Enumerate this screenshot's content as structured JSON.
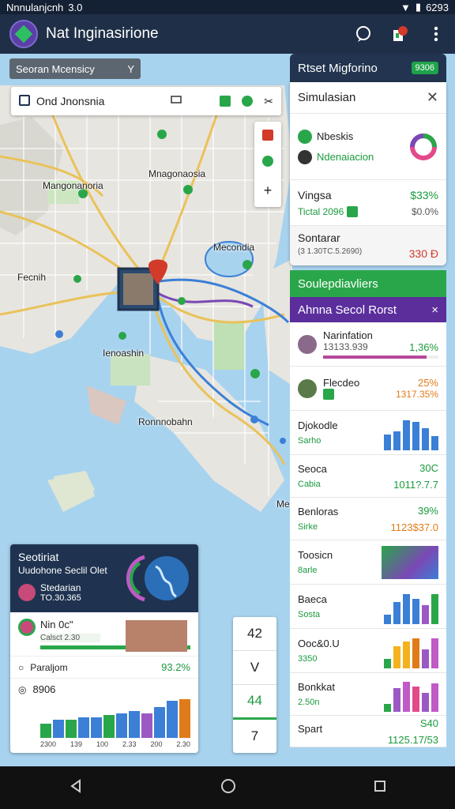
{
  "status_bar": {
    "carrier": "Nnnulanjcnh",
    "signal": "3.0",
    "battery": "6293"
  },
  "app_bar": {
    "title": "Nat Inginasirione"
  },
  "map": {
    "filter_chip": "Seoran Mcensicy",
    "search": {
      "value": "Ond Jnonsnia"
    },
    "labels": [
      "Mangonanoria",
      "Mnagonaosia",
      "Mecondia",
      "Fecnih",
      "Ienoashin",
      "Ronnnobahn",
      "Me"
    ],
    "tools": [
      "+"
    ],
    "zoom": [
      "42",
      "V",
      "44",
      "7"
    ]
  },
  "right_panel": {
    "header": {
      "title": "Rtset Migforino",
      "badge": "9306"
    },
    "simulation": {
      "title": "Simulasian",
      "items": [
        {
          "name": "Nbeskis"
        },
        {
          "name": "Ndenaiacion"
        }
      ]
    },
    "vingsa": {
      "label": "Vingsa",
      "value": "$33%",
      "sub": "Tictal 2096",
      "sub_value": "$0.0%"
    },
    "sontarar": {
      "label": "Sontarar",
      "sub": "(3 1.30TC.5.2690)",
      "value": "330 Ð"
    }
  },
  "results_panel": {
    "green_header": "Soulepdiavliers",
    "purple_header": "Ahnna Secol Rorst",
    "items": [
      {
        "name": "Narinfation",
        "sub": "13133.939",
        "value": "1,36%",
        "progress": 0.9,
        "progress_color": "#b7479a"
      },
      {
        "name": "Flecdeo",
        "sub": "",
        "value": "25%",
        "sub_value": "1317.35%"
      }
    ],
    "stats": [
      {
        "name": "Djokodle",
        "sub": "Sarho",
        "bars": [
          {
            "v": 0.5,
            "c": "#3b7fd6"
          },
          {
            "v": 0.6,
            "c": "#3b7fd6"
          },
          {
            "v": 0.95,
            "c": "#3b7fd6"
          },
          {
            "v": 0.9,
            "c": "#3b7fd6"
          },
          {
            "v": 0.7,
            "c": "#3b7fd6"
          },
          {
            "v": 0.45,
            "c": "#3b7fd6"
          }
        ]
      },
      {
        "name": "Seoca",
        "sub": "Cabia",
        "value": "30C",
        "sub_value": "1011?.7.7"
      },
      {
        "name": "Benloras",
        "sub": "Sirke",
        "value": "39%",
        "sub_value": "1123$37.0"
      },
      {
        "name": "Toosicn",
        "sub": "8arle"
      },
      {
        "name": "Baeca",
        "sub": "Sosta",
        "bars": [
          {
            "v": 0.3,
            "c": "#3b7fd6"
          },
          {
            "v": 0.7,
            "c": "#3b7fd6"
          },
          {
            "v": 0.95,
            "c": "#3b7fd6"
          },
          {
            "v": 0.8,
            "c": "#3b7fd6"
          },
          {
            "v": 0.6,
            "c": "#9b59c4"
          },
          {
            "v": 0.95,
            "c": "#2aa64a"
          }
        ]
      },
      {
        "name": "Ooc&0.U",
        "sub": "3350",
        "bars": [
          {
            "v": 0.3,
            "c": "#2aa64a"
          },
          {
            "v": 0.7,
            "c": "#f5b21f"
          },
          {
            "v": 0.85,
            "c": "#f5b21f"
          },
          {
            "v": 0.95,
            "c": "#e07b1a"
          },
          {
            "v": 0.6,
            "c": "#9b59c4"
          },
          {
            "v": 0.95,
            "c": "#c05ac6"
          }
        ]
      },
      {
        "name": "Bonkkat",
        "sub": "2.50n",
        "bars": [
          {
            "v": 0.25,
            "c": "#2aa64a"
          },
          {
            "v": 0.75,
            "c": "#9b59c4"
          },
          {
            "v": 0.95,
            "c": "#c05ac6"
          },
          {
            "v": 0.8,
            "c": "#e24a8a"
          },
          {
            "v": 0.6,
            "c": "#9b59c4"
          },
          {
            "v": 0.9,
            "c": "#c05ac6"
          }
        ]
      },
      {
        "name": "Spart",
        "sub": "",
        "value": "S40",
        "sub_value": "1125.17/53"
      }
    ]
  },
  "bottom_card": {
    "title": "Seotiriat",
    "subtitle": "Uudohone Seclil Olet",
    "user": {
      "name": "Stedarian",
      "sub": "TO.30.365"
    },
    "metric": {
      "label": "Nin 0c\"",
      "sub": "Calsct 2.30",
      "value": ""
    },
    "row2": {
      "label": "Paraljom",
      "value": "93.2%"
    },
    "chart": {
      "label": "8906",
      "ticks": [
        "2300",
        "139",
        "100",
        "2.33",
        "200",
        "2.30"
      ],
      "bars": [
        {
          "v": 0.35,
          "c": "#2aa64a"
        },
        {
          "v": 0.45,
          "c": "#3b7fd6"
        },
        {
          "v": 0.45,
          "c": "#2aa64a"
        },
        {
          "v": 0.5,
          "c": "#3b7fd6"
        },
        {
          "v": 0.5,
          "c": "#3b7fd6"
        },
        {
          "v": 0.55,
          "c": "#2aa64a"
        },
        {
          "v": 0.6,
          "c": "#3b7fd6"
        },
        {
          "v": 0.65,
          "c": "#3b7fd6"
        },
        {
          "v": 0.6,
          "c": "#9b59c4"
        },
        {
          "v": 0.75,
          "c": "#3b7fd6"
        },
        {
          "v": 0.9,
          "c": "#3b7fd6"
        },
        {
          "v": 0.95,
          "c": "#e07b1a"
        }
      ]
    }
  }
}
